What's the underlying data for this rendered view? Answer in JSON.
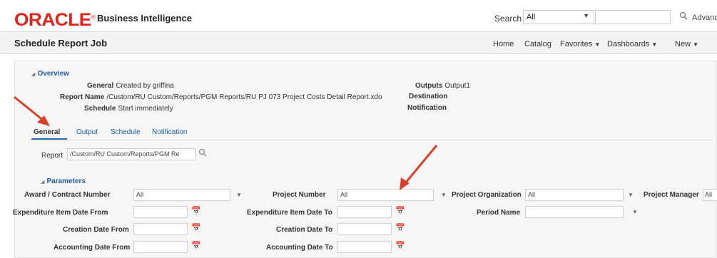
{
  "brand": {
    "logo_text": "ORACLE",
    "registered": "®",
    "product": "Business Intelligence",
    "logo_color": "#e2231a"
  },
  "topbar": {
    "search_label": "Search",
    "search_scope": "All",
    "advanced": "Advanced"
  },
  "header": {
    "title": "Schedule Report Job",
    "nav": {
      "home": "Home",
      "catalog": "Catalog",
      "favorites": "Favorites",
      "dashboards": "Dashboards",
      "new": "New"
    }
  },
  "overview": {
    "heading": "Overview",
    "general_label": "General",
    "general_value": "Created by griffina",
    "report_name_label": "Report Name",
    "report_name_value": "/Custom/RU Custom/Reports/PGM Reports/RU PJ 073 Project Costs Detail Report.xdo",
    "schedule_label": "Schedule",
    "schedule_value": "Start immediately",
    "outputs_label": "Outputs",
    "outputs_value": "Output1",
    "destination_label": "Destination",
    "notification_label": "Notification"
  },
  "tabs": {
    "general": "General",
    "output": "Output",
    "schedule": "Schedule",
    "notification": "Notification"
  },
  "report": {
    "label": "Report",
    "value": "/Custom/RU Custom/Reports/PGM Re"
  },
  "parameters": {
    "heading": "Parameters",
    "award_label": "Award / Contract Number",
    "award_value": "All",
    "project_number_label": "Project Number",
    "project_number_value": "All",
    "project_org_label": "Project Organization",
    "project_org_value": "All",
    "project_manager_label": "Project Manager",
    "project_manager_value": "All",
    "exp_from_label": "Expenditure Item Date From",
    "exp_to_label": "Expenditure Item Date To",
    "period_label": "Period Name",
    "creation_from_label": "Creation Date From",
    "creation_to_label": "Creation Date To",
    "accounting_from_label": "Accounting Date From",
    "accounting_to_label": "Accounting Date To"
  }
}
